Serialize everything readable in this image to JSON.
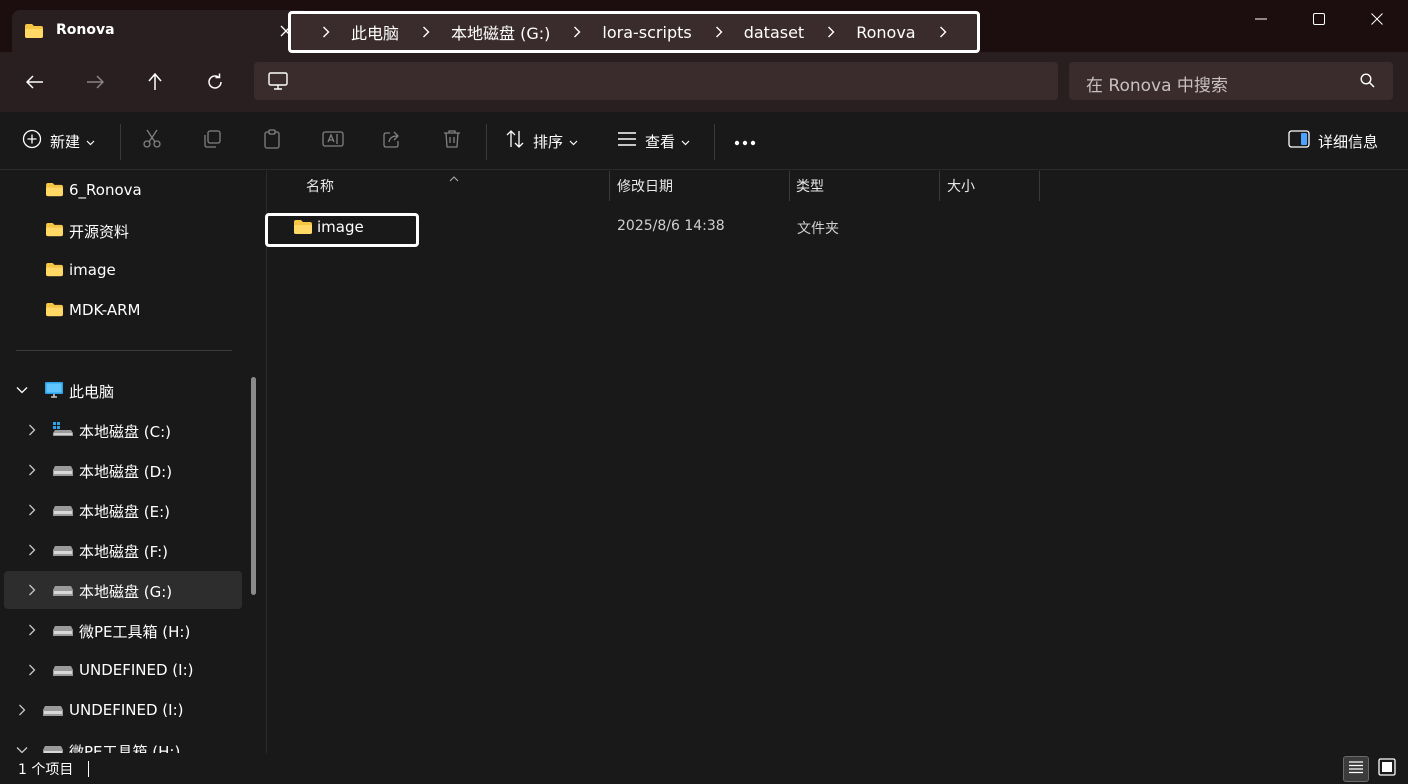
{
  "window": {
    "tab_title": "Ronova",
    "new_tab_symbol": "+"
  },
  "address": {
    "breadcrumbs": [
      "此电脑",
      "本地磁盘 (G:)",
      "lora-scripts",
      "dataset",
      "Ronova"
    ],
    "search_placeholder": "在 Ronova 中搜索"
  },
  "toolbar": {
    "new_label": "新建",
    "sort_label": "排序",
    "view_label": "查看",
    "more_label": "•••",
    "details_label": "详细信息"
  },
  "nav": {
    "quick_items": [
      "6_Ronova",
      "开源资料",
      "image",
      "MDK-ARM"
    ],
    "this_pc_label": "此电脑",
    "drives": [
      "本地磁盘 (C:)",
      "本地磁盘 (D:)",
      "本地磁盘 (E:)",
      "本地磁盘 (F:)",
      "本地磁盘 (G:)",
      "微PE工具箱 (H:)",
      "UNDEFINED (I:)"
    ],
    "undefined_root": "UNDEFINED (I:)",
    "pe_root": "微PE工具箱 (H:)"
  },
  "columns": {
    "name": "名称",
    "modified": "修改日期",
    "type": "类型",
    "size": "大小"
  },
  "files": [
    {
      "name": "image",
      "modified": "2025/8/6 14:38",
      "type": "文件夹",
      "size": ""
    }
  ],
  "status": {
    "item_count": "1 个项目"
  },
  "colors": {
    "folder": "#f6c544",
    "title_bg": "#1c0e0f",
    "nav_bg": "#2a1f20",
    "content_bg": "#191919"
  }
}
